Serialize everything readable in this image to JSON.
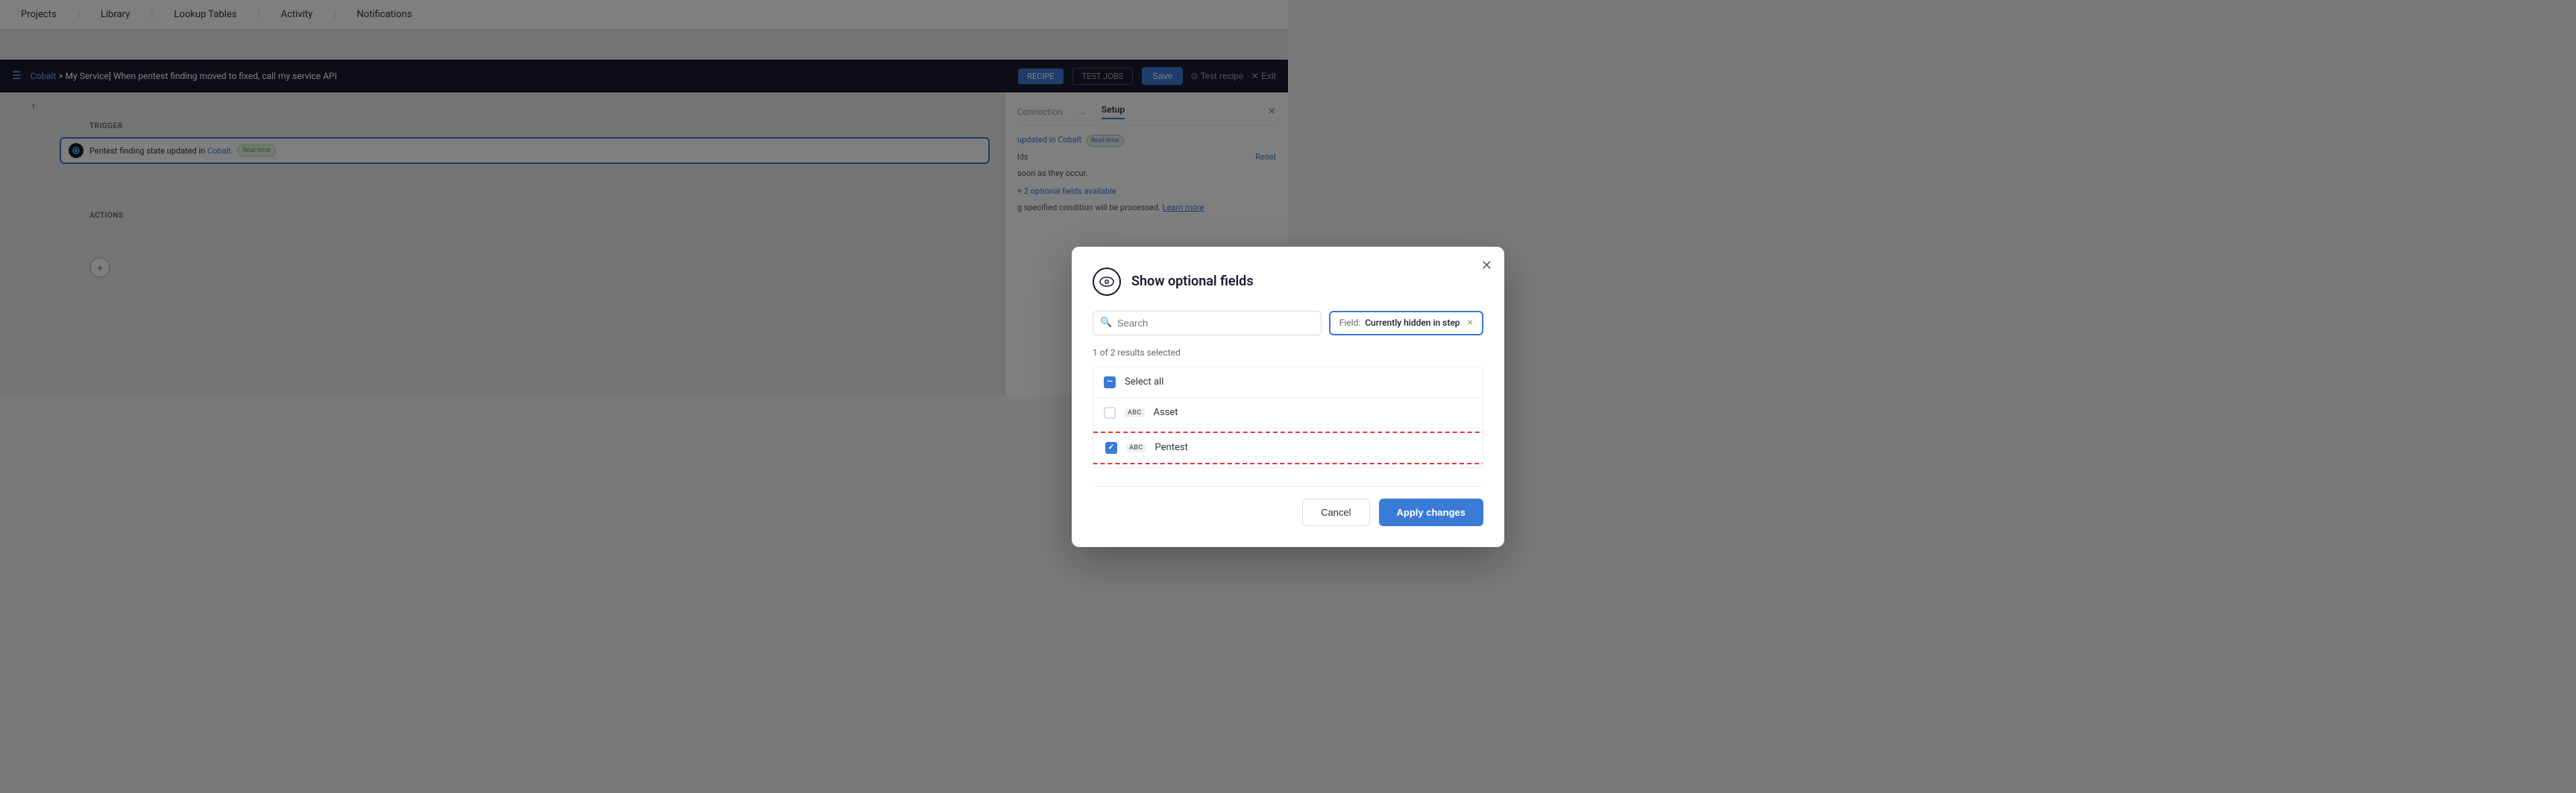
{
  "topNav": {
    "items": [
      "Projects",
      "Library",
      "Lookup Tables",
      "Activity",
      "Notifications"
    ]
  },
  "recipeHeader": {
    "title": "[Cobalt > My Service] When pentest finding moved to fixed, call my service API",
    "cobalt_link": "Cobalt",
    "tabs": [
      "RECIPE",
      "TEST JOBS"
    ],
    "active_tab": "RECIPE",
    "save_label": "Save",
    "test_label": "⊙ Test recipe",
    "exit_label": "✕ Exit"
  },
  "canvas": {
    "trigger_label": "TRIGGER",
    "actions_label": "ACTIONS",
    "trigger_item": {
      "number": "1",
      "text": "Pentest finding state updated in",
      "link_text": "Cobalt",
      "badge": "Real-time"
    }
  },
  "rightPanel": {
    "connection_tab": "Connection",
    "setup_tab": "Setup",
    "active_tab": "Setup",
    "subtitle": "updated in Cobalt",
    "badge": "Real-time",
    "fields_label": "lds",
    "reset_label": "Reset",
    "description": "soon as they occur.",
    "optional_fields": "+ 2 optional fields available",
    "learn_more_text": "g specified condition will be processed.",
    "learn_more_link": "Learn more"
  },
  "modal": {
    "title": "Show optional fields",
    "search_placeholder": "Search",
    "filter_label": "Field:",
    "filter_value": "Currently hidden in step",
    "results_info": "1 of 2 results selected",
    "select_all_label": "Select all",
    "options": [
      {
        "id": "asset",
        "label": "Asset",
        "type": "ABC",
        "checked": false
      },
      {
        "id": "pentest",
        "label": "Pentest",
        "type": "ABC",
        "checked": true,
        "highlighted": true
      }
    ],
    "cancel_label": "Cancel",
    "apply_label": "Apply changes"
  }
}
